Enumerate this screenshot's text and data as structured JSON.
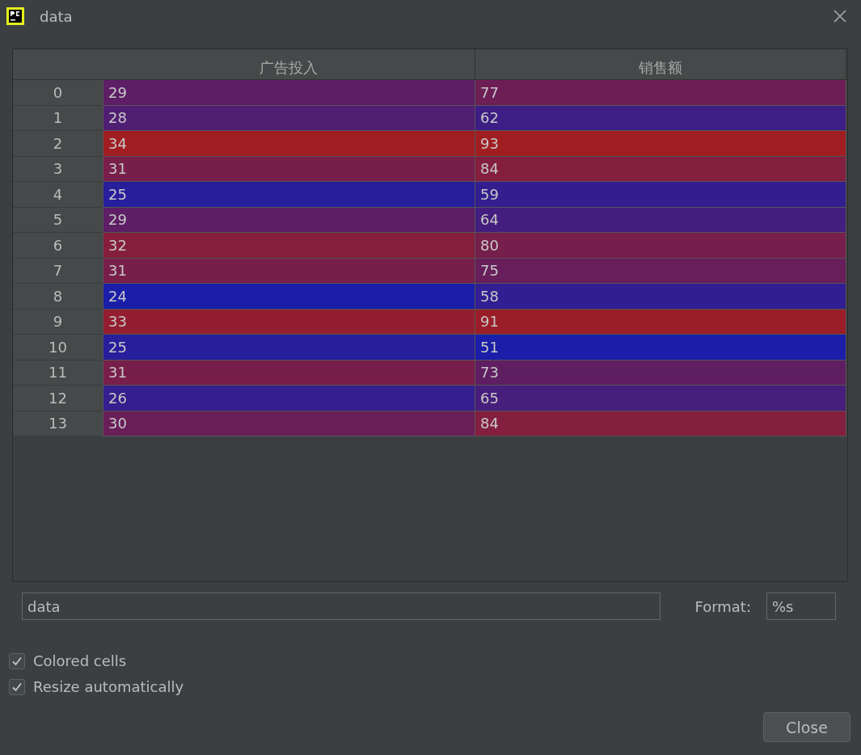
{
  "window": {
    "title": "data"
  },
  "table": {
    "columns": [
      "广告投入",
      "销售额"
    ],
    "rows": [
      {
        "index": "0",
        "cells": [
          {
            "value": "29",
            "color": "#5d1e65"
          },
          {
            "value": "77",
            "color": "#6d1e55"
          }
        ]
      },
      {
        "index": "1",
        "cells": [
          {
            "value": "28",
            "color": "#501e72"
          },
          {
            "value": "62",
            "color": "#3d1e85"
          }
        ]
      },
      {
        "index": "2",
        "cells": [
          {
            "value": "34",
            "color": "#a01e22"
          },
          {
            "value": "93",
            "color": "#a01e22"
          }
        ]
      },
      {
        "index": "3",
        "cells": [
          {
            "value": "31",
            "color": "#781e4a"
          },
          {
            "value": "84",
            "color": "#831e3f"
          }
        ]
      },
      {
        "index": "4",
        "cells": [
          {
            "value": "25",
            "color": "#271e9b"
          },
          {
            "value": "59",
            "color": "#331e8f"
          }
        ]
      },
      {
        "index": "5",
        "cells": [
          {
            "value": "29",
            "color": "#5d1e65"
          },
          {
            "value": "64",
            "color": "#441e7e"
          }
        ]
      },
      {
        "index": "6",
        "cells": [
          {
            "value": "32",
            "color": "#851e3d"
          },
          {
            "value": "80",
            "color": "#761e4c"
          }
        ]
      },
      {
        "index": "7",
        "cells": [
          {
            "value": "31",
            "color": "#781e4a"
          },
          {
            "value": "75",
            "color": "#671e5b"
          }
        ]
      },
      {
        "index": "8",
        "cells": [
          {
            "value": "24",
            "color": "#1a1ea8"
          },
          {
            "value": "58",
            "color": "#301e92"
          }
        ]
      },
      {
        "index": "9",
        "cells": [
          {
            "value": "33",
            "color": "#931e2f"
          },
          {
            "value": "91",
            "color": "#9a1e28"
          }
        ]
      },
      {
        "index": "10",
        "cells": [
          {
            "value": "25",
            "color": "#271e9b"
          },
          {
            "value": "51",
            "color": "#1a1ea8"
          }
        ]
      },
      {
        "index": "11",
        "cells": [
          {
            "value": "31",
            "color": "#781e4a"
          },
          {
            "value": "73",
            "color": "#601e62"
          }
        ]
      },
      {
        "index": "12",
        "cells": [
          {
            "value": "26",
            "color": "#351e8d"
          },
          {
            "value": "65",
            "color": "#471e7b"
          }
        ]
      },
      {
        "index": "13",
        "cells": [
          {
            "value": "30",
            "color": "#6a1e58"
          },
          {
            "value": "84",
            "color": "#831e3f"
          }
        ]
      }
    ]
  },
  "expression_field": {
    "value": "data"
  },
  "format": {
    "label": "Format:",
    "value": "%s"
  },
  "checkboxes": [
    {
      "label": "Colored cells",
      "checked": true
    },
    {
      "label": "Resize automatically",
      "checked": true
    }
  ],
  "buttons": [
    "Close"
  ]
}
